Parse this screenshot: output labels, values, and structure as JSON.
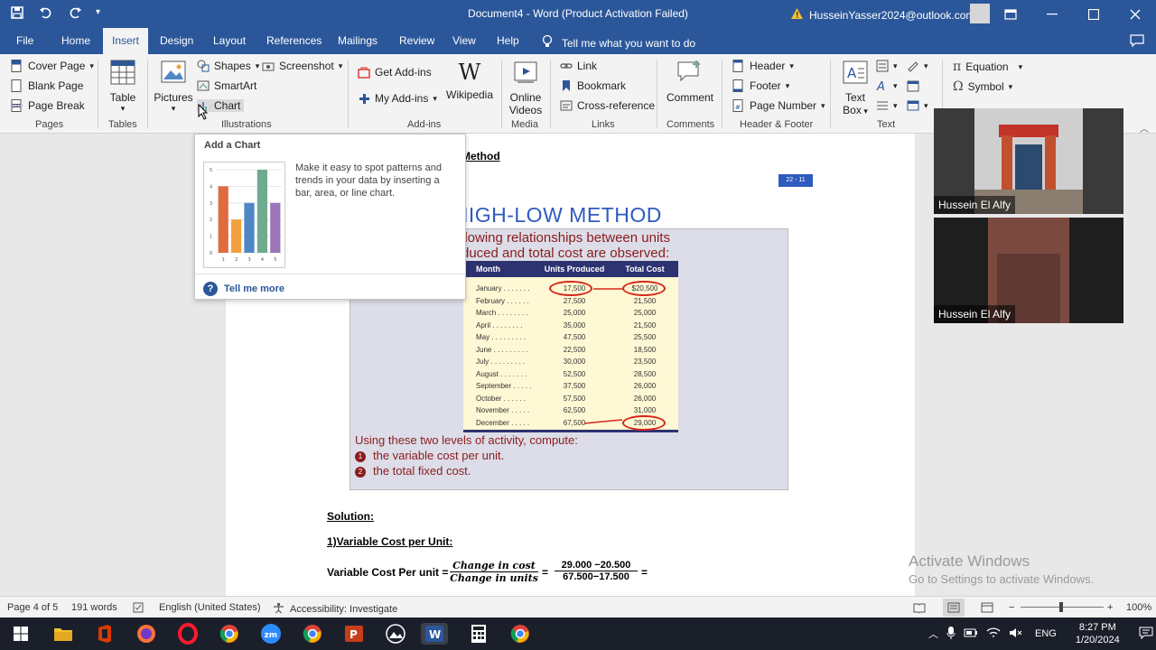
{
  "window": {
    "title": "Document4 - Word (Product Activation Failed)",
    "account": "HusseinYasser2024@outlook.com"
  },
  "tabs": [
    "File",
    "Home",
    "Insert",
    "Design",
    "Layout",
    "References",
    "Mailings",
    "Review",
    "View",
    "Help"
  ],
  "active_tab": "Insert",
  "tell_me": "Tell me what you want to do",
  "ribbon": {
    "pages": {
      "cover_page": "Cover Page",
      "blank_page": "Blank Page",
      "page_break": "Page Break",
      "label": "Pages"
    },
    "tables": {
      "table": "Table",
      "label": "Tables"
    },
    "illustrations": {
      "pictures": "Pictures",
      "shapes": "Shapes",
      "screenshot": "Screenshot",
      "smartart": "SmartArt",
      "chart": "Chart",
      "label": "Illustrations"
    },
    "addins": {
      "get_addins": "Get Add-ins",
      "my_addins": "My Add-ins",
      "wikipedia": "Wikipedia",
      "label": "Add-ins"
    },
    "media": {
      "online_videos_1": "Online",
      "online_videos_2": "Videos",
      "label": "Media"
    },
    "links": {
      "link": "Link",
      "bookmark": "Bookmark",
      "cross_reference": "Cross-reference",
      "label": "Links"
    },
    "comments": {
      "comment": "Comment",
      "label": "Comments"
    },
    "header_footer": {
      "header": "Header",
      "footer": "Footer",
      "page_number": "Page Number",
      "label": "Header & Footer"
    },
    "text": {
      "text_box_1": "Text",
      "text_box_2": "Box",
      "label": "Text"
    },
    "symbols": {
      "equation": "Equation",
      "symbol": "Symbol"
    }
  },
  "tooltip": {
    "title": "Add a Chart",
    "description": "Make it easy to spot patterns and trends in your data by inserting a bar, area, or line chart.",
    "tell_me_more": "Tell me more",
    "chart_values": [
      4,
      2,
      3,
      5,
      3
    ],
    "chart_colors": [
      "#e06b3f",
      "#f2a03d",
      "#4f86c6",
      "#6fab8e",
      "#9b76b8"
    ],
    "y_ticks": [
      "0",
      "1",
      "2",
      "3",
      "4",
      "5"
    ],
    "x_ticks": [
      "1",
      "2",
      "3",
      "4",
      "5"
    ]
  },
  "document": {
    "heading_fragment": "Method",
    "slide": {
      "number": "22 - 11",
      "title": "E HIGH-LOW METHOD",
      "subtitle_1": "llowing relationships between units",
      "subtitle_2": "duced and total cost are observed:",
      "table_headers": [
        "Month",
        "Units Produced",
        "Total Cost"
      ],
      "table_rows": [
        [
          "January . . . . . . .",
          "17,500",
          "$20,500"
        ],
        [
          "February . . . . . .",
          "27,500",
          "21,500"
        ],
        [
          "March . . . . . . . .",
          "25,000",
          "25,000"
        ],
        [
          "April . . . . . . . .",
          "35,000",
          "21,500"
        ],
        [
          "May . . . . . . . . .",
          "47,500",
          "25,500"
        ],
        [
          "June . . . . . . . . .",
          "22,500",
          "18,500"
        ],
        [
          "July . . . . . . . . .",
          "30,000",
          "23,500"
        ],
        [
          "August . . . . . . .",
          "52,500",
          "28,500"
        ],
        [
          "September . . . . .",
          "37,500",
          "26,000"
        ],
        [
          "October . . . . . .",
          "57,500",
          "26,000"
        ],
        [
          "November . . . . .",
          "62,500",
          "31,000"
        ],
        [
          "December . . . . .",
          "67,500",
          "29,000"
        ]
      ],
      "bottom_1": "Using these two levels of activity, compute:",
      "bottom_2": "the variable cost per unit.",
      "bottom_3": "the total fixed cost.",
      "badge_1": "1",
      "badge_2": "2"
    },
    "solution": "Solution:",
    "vc_heading": "1)Variable Cost per Unit:",
    "vc_label": "Variable Cost Per unit =",
    "frac1_num": "Change in cost",
    "frac1_den": "Change in units",
    "eq": "=",
    "frac2_num": "29.000 −20.500",
    "frac2_den": "67.500−17.500",
    "eq2": "="
  },
  "video": {
    "participant_1": "Hussein El Alfy",
    "participant_2": "Hussein El Alfy"
  },
  "watermark": {
    "line1": "Activate Windows",
    "line2": "Go to Settings to activate Windows."
  },
  "status": {
    "page": "Page 4 of 5",
    "words": "191 words",
    "language": "English (United States)",
    "accessibility": "Accessibility: Investigate",
    "zoom": "100%"
  },
  "taskbar": {
    "lang": "ENG",
    "time": "8:27 PM",
    "date": "1/20/2024"
  }
}
